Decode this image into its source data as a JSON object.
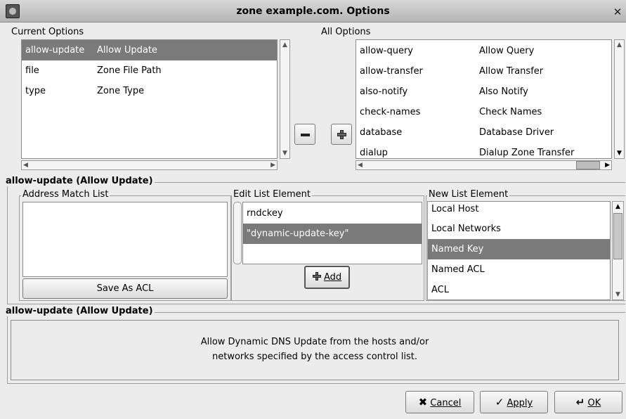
{
  "window": {
    "title": "zone example.com. Options"
  },
  "current_options": {
    "label": "Current Options",
    "rows": [
      {
        "key": "allow-update",
        "desc": "Allow Update"
      },
      {
        "key": "file",
        "desc": "Zone File Path"
      },
      {
        "key": "type",
        "desc": "Zone Type"
      }
    ]
  },
  "all_options": {
    "label": "All Options",
    "rows": [
      {
        "key": "allow-query",
        "desc": "Allow Query"
      },
      {
        "key": "allow-transfer",
        "desc": "Allow Transfer"
      },
      {
        "key": "also-notify",
        "desc": "Also Notify"
      },
      {
        "key": "check-names",
        "desc": "Check Names"
      },
      {
        "key": "database",
        "desc": "Database Driver"
      },
      {
        "key": "dialup",
        "desc": "Dialup Zone Transfer"
      }
    ]
  },
  "section1": {
    "title": "allow-update (Allow Update)",
    "address_match_list_label": "Address Match List",
    "save_as_acl_label": "Save As ACL",
    "edit_list_element_label": "Edit List Element",
    "edit_items": [
      "rndckey",
      "\"dynamic-update-key\""
    ],
    "add_label": "Add",
    "new_list_element_label": "New List Element",
    "new_items": [
      "Local Host",
      "Local Networks",
      "Named Key",
      "Named ACL",
      "ACL"
    ]
  },
  "section2": {
    "title": "allow-update (Allow Update)",
    "description_line1": "Allow Dynamic DNS Update from the hosts and/or",
    "description_line2": "networks specified by the access control list."
  },
  "buttons": {
    "cancel": "Cancel",
    "apply": "Apply",
    "ok": "OK"
  },
  "icons": {
    "remove": "minus-icon",
    "add": "plus-icon",
    "cancel": "x-icon",
    "apply": "check-icon",
    "ok": "ok-icon"
  }
}
